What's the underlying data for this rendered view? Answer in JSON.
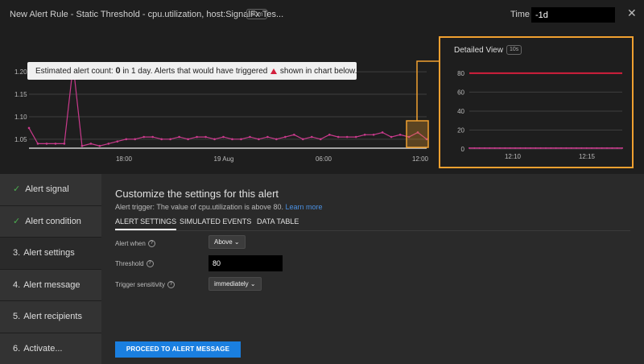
{
  "header": {
    "title": "New Alert Rule - Static Threshold - cpu.utilization, host:SignalFx Tes...",
    "title_tag": "30m",
    "time_label": "Time",
    "time_value": "-1d",
    "close_glyph": "✕"
  },
  "estimate": {
    "prefix": "Estimated alert count:",
    "count": "0",
    "middle": "in 1 day. Alerts that would have triggered",
    "suffix": "shown in chart below.",
    "marker_color": "#d21f3c"
  },
  "main_chart": {
    "y_ticks": [
      "1.20",
      "1.15",
      "1.10",
      "1.05"
    ],
    "x_ticks": [
      "18:00",
      "19 Aug",
      "06:00",
      "12:00"
    ],
    "series_color": "#c93a8c",
    "chart_data": {
      "type": "line",
      "ylim": [
        1.03,
        1.22
      ],
      "values": [
        1.075,
        1.04,
        1.04,
        1.04,
        1.04,
        1.215,
        1.035,
        1.04,
        1.035,
        1.04,
        1.045,
        1.05,
        1.05,
        1.055,
        1.055,
        1.05,
        1.05,
        1.055,
        1.05,
        1.055,
        1.055,
        1.05,
        1.055,
        1.05,
        1.05,
        1.055,
        1.05,
        1.055,
        1.05,
        1.055,
        1.06,
        1.05,
        1.055,
        1.05,
        1.06,
        1.055,
        1.055,
        1.055,
        1.06,
        1.06,
        1.065,
        1.055,
        1.06,
        1.055,
        1.065,
        1.05
      ]
    }
  },
  "detail_view": {
    "title": "Detailed View",
    "tag": "10s",
    "y_ticks": [
      "80",
      "60",
      "40",
      "20",
      "0"
    ],
    "x_ticks": [
      "12:10",
      "12:15"
    ],
    "threshold_color": "#d21f3c",
    "series_color": "#c93a8c",
    "chart_data": {
      "type": "line",
      "ylim": [
        0,
        85
      ],
      "threshold": 80,
      "series_value": 1
    }
  },
  "sidebar": {
    "check_icon": "✓",
    "steps": [
      {
        "label": "Alert signal",
        "done": true,
        "num": ""
      },
      {
        "label": "Alert condition",
        "done": true,
        "num": ""
      },
      {
        "label": "Alert settings",
        "done": false,
        "num": "3."
      },
      {
        "label": "Alert message",
        "done": false,
        "num": "4."
      },
      {
        "label": "Alert recipients",
        "done": false,
        "num": "5."
      },
      {
        "label": "Activate...",
        "done": false,
        "num": "6."
      }
    ]
  },
  "settings": {
    "title": "Customize the settings for this alert",
    "trigger_text": "Alert trigger: The value of cpu.utilization is above 80.",
    "learn_more": "Learn more",
    "tabs": [
      "ALERT SETTINGS",
      "SIMULATED EVENTS",
      "DATA TABLE"
    ],
    "help_glyph": "?",
    "alert_when": {
      "label": "Alert when",
      "value": "Above"
    },
    "threshold": {
      "label": "Threshold",
      "value": "80"
    },
    "sensitivity": {
      "label": "Trigger sensitivity",
      "value": "immediately"
    },
    "chevron": "⌄",
    "proceed_button": "PROCEED TO ALERT MESSAGE"
  }
}
